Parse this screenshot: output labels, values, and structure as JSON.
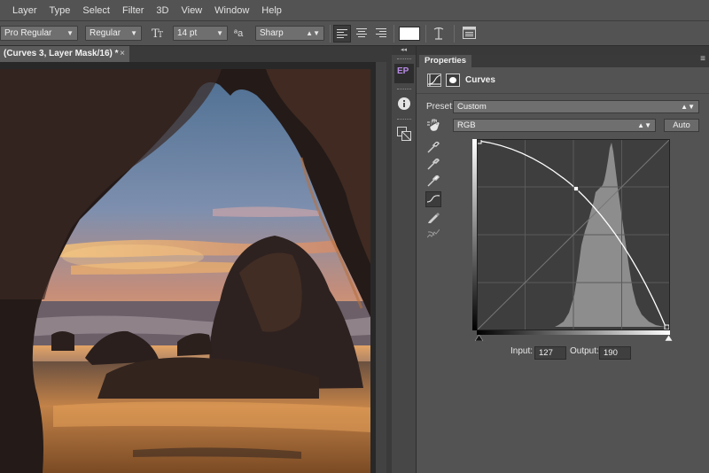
{
  "menu": [
    "Layer",
    "Type",
    "Select",
    "Filter",
    "3D",
    "View",
    "Window",
    "Help"
  ],
  "options_bar": {
    "font_family": "Pro Regular",
    "font_style": "Regular",
    "font_size": "14 pt",
    "anti_alias": "Sharp",
    "text_color": "#ffffff"
  },
  "document": {
    "tab_title": "(Curves 3, Layer Mask/16) *",
    "close_glyph": "×"
  },
  "panel": {
    "tab_label": "Properties",
    "title": "Curves",
    "preset_label": "Preset:",
    "preset_value": "Custom",
    "channel_value": "RGB",
    "auto_label": "Auto",
    "input_label": "Input:",
    "input_value": "127",
    "output_label": "Output:",
    "output_value": "190"
  },
  "dock": {
    "ep_label": "EP"
  },
  "colors": {
    "ep_accent": "#b88ae8",
    "ui_bg": "#535353",
    "curve_line": "#ffffff"
  }
}
